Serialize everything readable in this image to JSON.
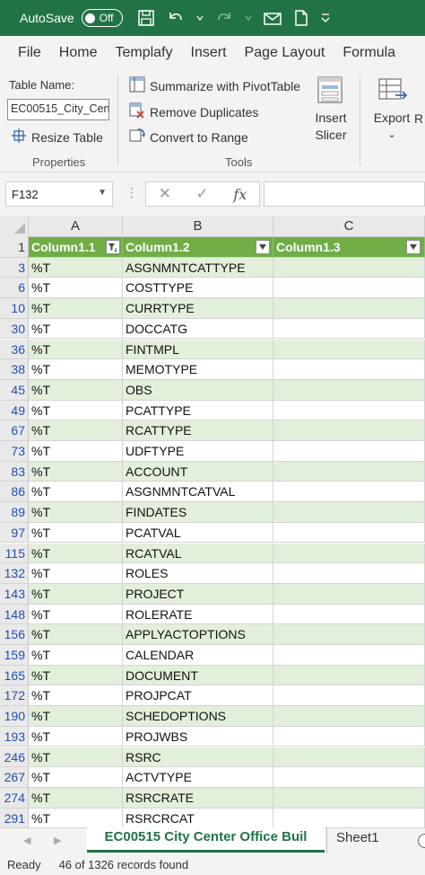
{
  "titlebar": {
    "autosave_label": "AutoSave",
    "autosave_state": "Off"
  },
  "ribbon_tabs": [
    "File",
    "Home",
    "Templafy",
    "Insert",
    "Page Layout",
    "Formula"
  ],
  "ribbon": {
    "table_name_label": "Table Name:",
    "table_name_value": "EC00515_City_Cen",
    "resize_table": "Resize Table",
    "properties_group": "Properties",
    "summarize_pivot": "Summarize with PivotTable",
    "remove_duplicates": "Remove Duplicates",
    "convert_to_range": "Convert to Range",
    "tools_group": "Tools",
    "insert_slicer_line1": "Insert",
    "insert_slicer_line2": "Slicer",
    "export_label": "Export",
    "export_r": "R"
  },
  "formula_bar": {
    "name_box": "F132",
    "fx": "fx",
    "formula_value": ""
  },
  "columns": [
    "A",
    "B",
    "C"
  ],
  "table_header": {
    "row_number": "1",
    "col_a": "Column1.1",
    "col_b": "Column1.2",
    "col_c": "Column1.3"
  },
  "rows": [
    {
      "n": "3",
      "a": "%T",
      "b": "ASGNMNTCATTYPE",
      "c": ""
    },
    {
      "n": "6",
      "a": "%T",
      "b": "COSTTYPE",
      "c": ""
    },
    {
      "n": "10",
      "a": "%T",
      "b": "CURRTYPE",
      "c": ""
    },
    {
      "n": "30",
      "a": "%T",
      "b": "DOCCATG",
      "c": ""
    },
    {
      "n": "36",
      "a": "%T",
      "b": "FINTMPL",
      "c": ""
    },
    {
      "n": "38",
      "a": "%T",
      "b": "MEMOTYPE",
      "c": ""
    },
    {
      "n": "45",
      "a": "%T",
      "b": "OBS",
      "c": ""
    },
    {
      "n": "49",
      "a": "%T",
      "b": "PCATTYPE",
      "c": ""
    },
    {
      "n": "67",
      "a": "%T",
      "b": "RCATTYPE",
      "c": ""
    },
    {
      "n": "73",
      "a": "%T",
      "b": "UDFTYPE",
      "c": ""
    },
    {
      "n": "83",
      "a": "%T",
      "b": "ACCOUNT",
      "c": ""
    },
    {
      "n": "86",
      "a": "%T",
      "b": "ASGNMNTCATVAL",
      "c": ""
    },
    {
      "n": "89",
      "a": "%T",
      "b": "FINDATES",
      "c": ""
    },
    {
      "n": "97",
      "a": "%T",
      "b": "PCATVAL",
      "c": ""
    },
    {
      "n": "115",
      "a": "%T",
      "b": "RCATVAL",
      "c": ""
    },
    {
      "n": "132",
      "a": "%T",
      "b": "ROLES",
      "c": ""
    },
    {
      "n": "143",
      "a": "%T",
      "b": "PROJECT",
      "c": ""
    },
    {
      "n": "148",
      "a": "%T",
      "b": "ROLERATE",
      "c": ""
    },
    {
      "n": "156",
      "a": "%T",
      "b": "APPLYACTOPTIONS",
      "c": ""
    },
    {
      "n": "159",
      "a": "%T",
      "b": "CALENDAR",
      "c": ""
    },
    {
      "n": "165",
      "a": "%T",
      "b": "DOCUMENT",
      "c": ""
    },
    {
      "n": "172",
      "a": "%T",
      "b": "PROJPCAT",
      "c": ""
    },
    {
      "n": "190",
      "a": "%T",
      "b": "SCHEDOPTIONS",
      "c": ""
    },
    {
      "n": "193",
      "a": "%T",
      "b": "PROJWBS",
      "c": ""
    },
    {
      "n": "246",
      "a": "%T",
      "b": "RSRC",
      "c": ""
    },
    {
      "n": "267",
      "a": "%T",
      "b": "ACTVTYPE",
      "c": ""
    },
    {
      "n": "274",
      "a": "%T",
      "b": "RSRCRATE",
      "c": ""
    },
    {
      "n": "291",
      "a": "%T",
      "b": "RSRCRCAT",
      "c": ""
    }
  ],
  "sheet_tabs": {
    "active": "EC00515 City Center Office Buil",
    "other": "Sheet1"
  },
  "status": {
    "ready": "Ready",
    "records": "46 of 1326 records found"
  },
  "colors": {
    "excel_green": "#217346",
    "table_header": "#70ad47",
    "band": "#e2efda",
    "row_number_blue": "#1f4fb5"
  }
}
